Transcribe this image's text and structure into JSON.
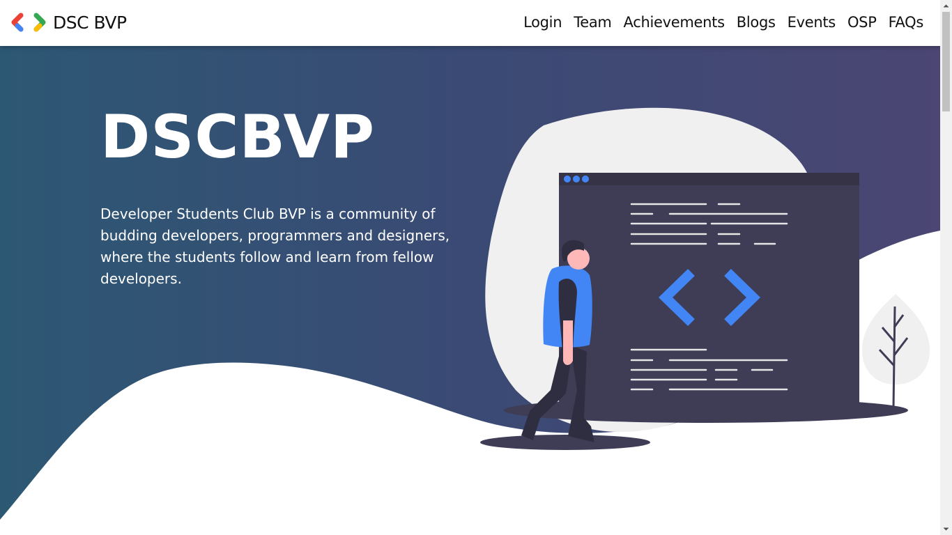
{
  "nav": {
    "brand": "DSC BVP",
    "logo_icon": "dsc-chevrons-logo",
    "links": [
      "Login",
      "Team",
      "Achievements",
      "Blogs",
      "Events",
      "OSP",
      "FAQs"
    ]
  },
  "hero": {
    "title": "DSCBVP",
    "description": "Developer Students Club BVP is a community of budding developers, programmers and designers, where the students follow and learn from fellow developers.",
    "illustration": "developer-with-code-window",
    "colors": {
      "gradient_start": "#2d5874",
      "gradient_end": "#4b4673",
      "accent_blue": "#4285f4"
    }
  },
  "scrollbar": {
    "up_icon": "scroll-up-arrow-icon",
    "down_icon": "scroll-down-arrow-icon"
  }
}
